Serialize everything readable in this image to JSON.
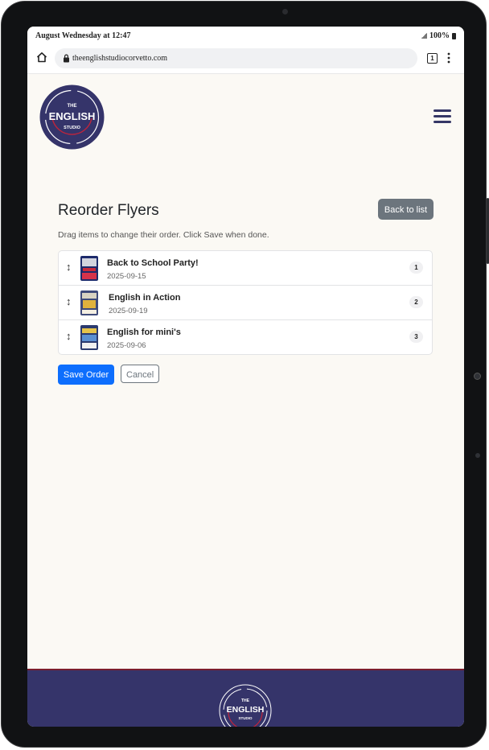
{
  "status_bar": {
    "time": "August Wednesday at 12:47",
    "battery": "100%"
  },
  "browser": {
    "url": "theenglishstudiocorvetto.com",
    "tab_count": "1"
  },
  "logo": {
    "line1": "THE",
    "line2": "ENGLISH",
    "line3": "STUDIO"
  },
  "page": {
    "title": "Reorder Flyers",
    "back_label": "Back to list",
    "hint": "Drag items to change their order. Click Save when done."
  },
  "flyers": [
    {
      "title": "Back to School Party!",
      "date": "2025-09-15",
      "order": "1"
    },
    {
      "title": "English in Action",
      "date": "2025-09-19",
      "order": "2"
    },
    {
      "title": "English for mini's",
      "date": "2025-09-06",
      "order": "3"
    }
  ],
  "actions": {
    "save_label": "Save Order",
    "cancel_label": "Cancel"
  },
  "colors": {
    "brand_navy": "#35346a",
    "primary": "#0d6efd",
    "secondary": "#6c757d",
    "accent_red": "#7b1e2e"
  },
  "icons": [
    "home-icon",
    "lock-icon",
    "tabs-icon",
    "more-vert-icon",
    "hamburger-menu-icon",
    "drag-handle-icon"
  ]
}
